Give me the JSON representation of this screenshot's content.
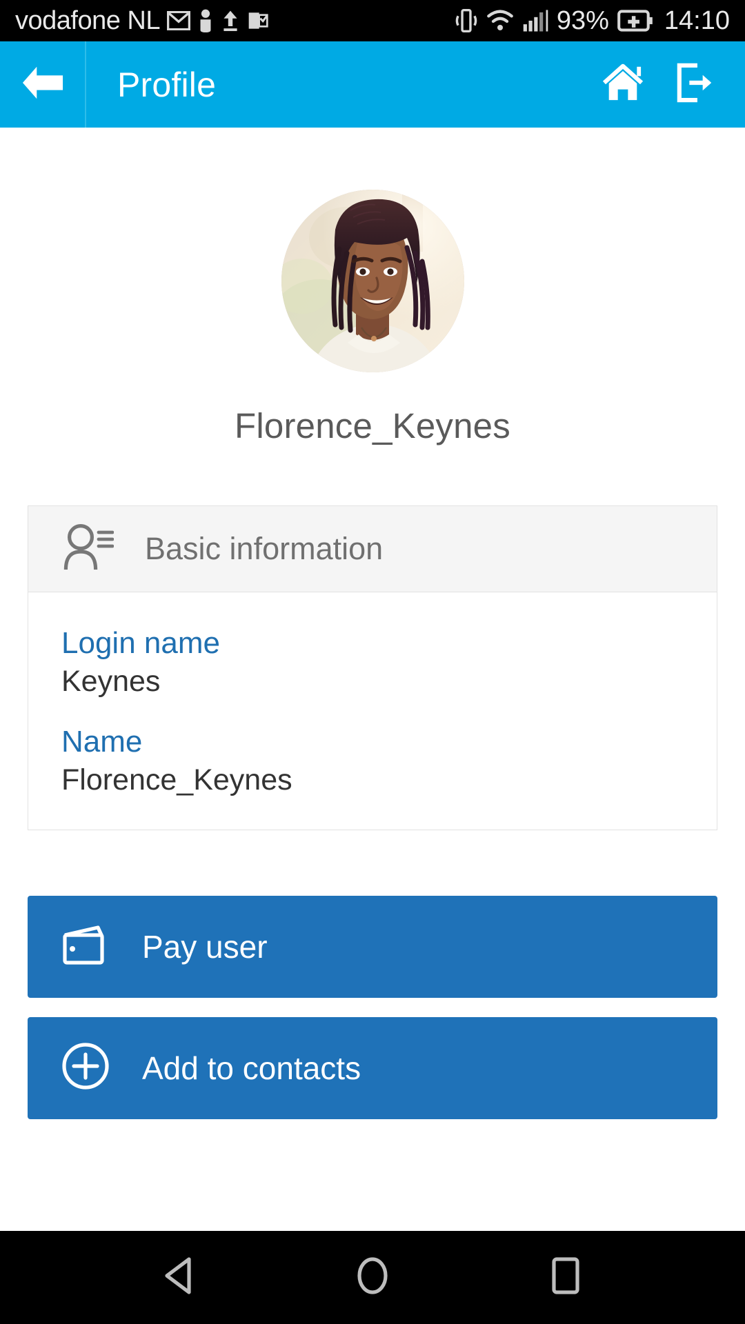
{
  "statusbar": {
    "carrier": "vodafone NL",
    "battery_percent": "93%",
    "clock": "14:10",
    "icons": [
      "gmail-icon",
      "person-notification-icon",
      "upload-icon",
      "outlook-icon",
      "vibrate-icon",
      "wifi-icon",
      "signal-icon",
      "battery-charging-icon"
    ]
  },
  "appbar": {
    "title": "Profile",
    "back_icon": "back-arrow-icon",
    "home_icon": "home-icon",
    "logout_icon": "logout-icon",
    "background_color": "#00AAE4"
  },
  "profile": {
    "avatar_alt": "user-avatar-photo",
    "display_name": "Florence_Keynes"
  },
  "basic_information": {
    "icon": "contact-details-icon",
    "header": "Basic information",
    "fields": [
      {
        "label": "Login name",
        "value": "Keynes"
      },
      {
        "label": "Name",
        "value": "Florence_Keynes"
      }
    ]
  },
  "actions": [
    {
      "icon": "wallet-icon",
      "label": "Pay user"
    },
    {
      "icon": "add-circle-icon",
      "label": "Add to contacts"
    }
  ],
  "navbar": {
    "back": "nav-back-icon",
    "home": "nav-home-icon",
    "recents": "nav-recents-icon"
  },
  "colors": {
    "accent": "#00AAE4",
    "button": "#1F72B8",
    "label_blue": "#1F6FB0"
  }
}
